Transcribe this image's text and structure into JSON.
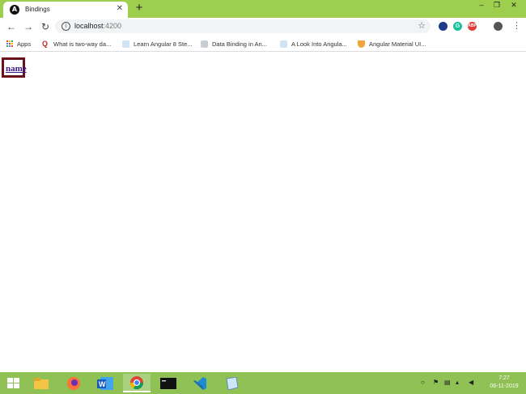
{
  "browser": {
    "tab": {
      "title": "Bindings",
      "favicon_letter": "A",
      "close_glyph": "✕"
    },
    "new_tab_glyph": "+",
    "window_controls": {
      "minimize": "–",
      "restore": "❐",
      "close": "✕"
    },
    "nav": {
      "back": "←",
      "forward": "→",
      "reload": "↻"
    },
    "address": {
      "host": "localhost",
      "port": ":4200"
    },
    "icons": {
      "star": "☆",
      "menu": "⋮",
      "info": "i",
      "ext_grammarly": "G",
      "ext_abp": "ABP"
    },
    "bookmarks": [
      {
        "label": "Apps",
        "icon": "apps-grid-icon"
      },
      {
        "label": "What is two-way da...",
        "icon": "quora-icon"
      },
      {
        "label": "Learn Angular 8 Ste...",
        "icon": "page-icon"
      },
      {
        "label": "Data Binding in An...",
        "icon": "page-icon"
      },
      {
        "label": "A Look Into Angula...",
        "icon": "page-icon"
      },
      {
        "label": "Angular Material UI...",
        "icon": "shield-icon"
      }
    ]
  },
  "page": {
    "link_text": "name"
  },
  "taskbar": {
    "apps": [
      "file-explorer-icon",
      "firefox-icon",
      "word-icon",
      "chrome-icon",
      "cmd-icon",
      "vscode-icon",
      "notes-icon"
    ],
    "clock": {
      "time": "7:27",
      "date": "06-11-2019"
    }
  },
  "colors": {
    "accent": "#9ece4e",
    "taskbar": "#8fc154",
    "link_border": "#6b0f1a",
    "link": "#3b1a86"
  }
}
